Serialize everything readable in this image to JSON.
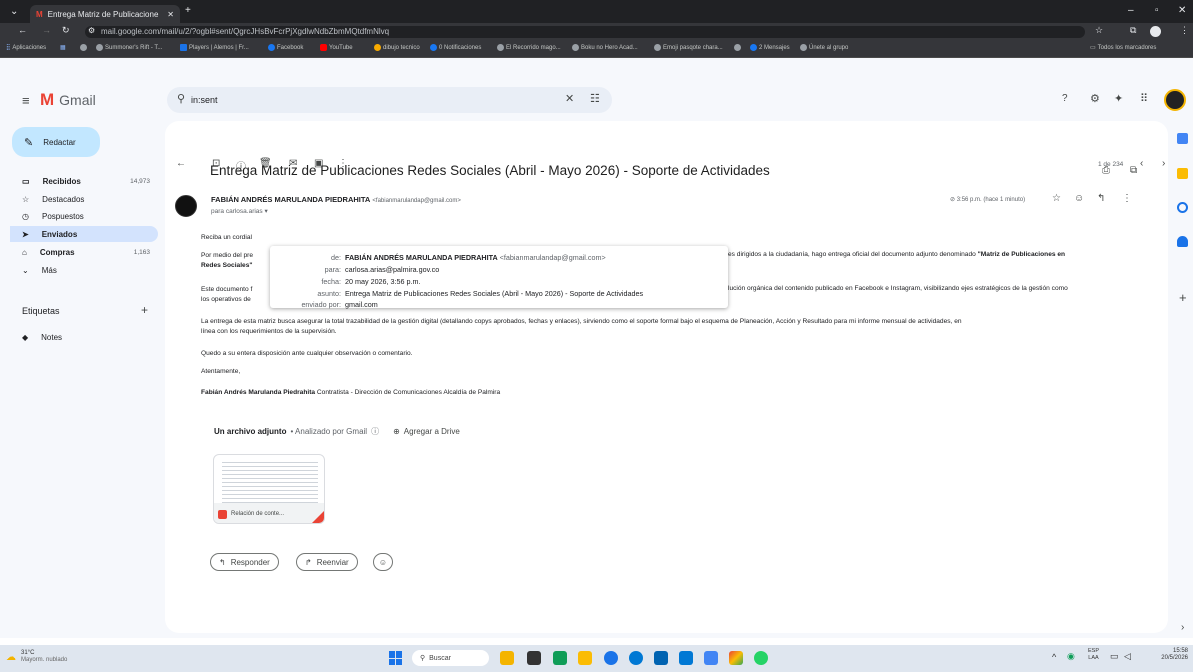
{
  "browser": {
    "tab_title": "Entrega Matriz de Publicacione",
    "url": "mail.google.com/mail/u/2/?ogbl#sent/QgrcJHsBvFcrPjXgdlwNdbZbmMQtdfmNlvq",
    "bookmarks": [
      "Aplicaciones",
      "",
      "Summoner's Rift - T...",
      "Players | Alemos | Fr...",
      "Facebook",
      "YouTube",
      "dibujo tecnico",
      "0 Notificaciones",
      "El Recorrido mago...",
      "Boku no Hero Acad...",
      "Emoji pasqote chara...",
      "",
      "2 Mensajes",
      "Únete al grupo"
    ],
    "bookmarks_right": "Todos los marcadores"
  },
  "gmail": {
    "logo": "Gmail",
    "search_value": "in:sent",
    "compose": "Redactar",
    "nav": [
      {
        "label": "Recibidos",
        "count": "14,973",
        "bold": true
      },
      {
        "label": "Destacados",
        "count": ""
      },
      {
        "label": "Pospuestos",
        "count": ""
      },
      {
        "label": "Enviados",
        "count": "",
        "bold": true
      },
      {
        "label": "Compras",
        "count": "1,163",
        "bold": true
      },
      {
        "label": "Más",
        "count": ""
      }
    ],
    "labels_heading": "Etiquetas",
    "labels": [
      "Notes"
    ],
    "pager": "1 de 234",
    "subject": "Entrega Matriz de Publicaciones Redes Sociales (Abril - Mayo 2026) - Soporte de Actividades",
    "sender_name": "FABIÁN ANDRÉS MARULANDA PIEDRAHITA",
    "sender_email": "<fabianmarulandap@gmail.com>",
    "to_line": "para carlosa.arias",
    "time": "3:56 p.m. (hace 1 minuto)",
    "details": {
      "from_k": "de:",
      "from_name": "FABIÁN ANDRÉS MARULANDA PIEDRAHITA",
      "from_email": "<fabianmarulandap@gmail.com>",
      "to_k": "para:",
      "to_v": "carlosa.arias@palmira.gov.co",
      "date_k": "fecha:",
      "date_v": "20 may 2026, 3:56 p.m.",
      "subj_k": "asunto:",
      "subj_v": "Entrega Matriz de Publicaciones Redes Sociales (Abril - Mayo 2026) - Soporte de Actividades",
      "via_k": "enviado por:",
      "via_v": "gmail.com"
    },
    "body": {
      "p1": "Reciba un cordial",
      "p2a": "Por medio del pre",
      "p2b": "es dirigidos a la ciudadanía, hago entrega oficial del documento adjunto denominado",
      "p2c": "\"Matriz de Publicaciones en",
      "p2d": "Redes Sociales\"",
      "p3a": "Este documento f",
      "p3b": "lución orgánica del contenido publicado en Facebook e Instagram, visibilizando ejes estratégicos de la gestión como",
      "p3c": "los operativos de",
      "p4": "La entrega de esta matriz busca asegurar la total trazabilidad de la gestión digital (detallando copys aprobados, fechas y enlaces), sirviendo como el soporte formal bajo el esquema de Planeación, Acción y Resultado para mi informe mensual de actividades, en",
      "p4b": "línea con los requerimientos de la supervisión.",
      "p5": "Quedo a su entera disposición ante cualquier observación o comentario.",
      "p6": "Atentamente,",
      "p7a": "Fabián Andrés Marulanda Piedrahita",
      "p7b": "Contratista - Dirección de Comunicaciones Alcaldía de Palmira"
    },
    "attach_head": "Un archivo adjunto",
    "attach_scan": "• Analizado por Gmail",
    "attach_drive": "Agregar a Drive",
    "attach_name": "Relación de conte...",
    "reply": "Responder",
    "forward": "Reenviar"
  },
  "taskbar": {
    "weather_temp": "31°C",
    "weather_desc": "Mayorm. nublado",
    "search": "Buscar",
    "lang1": "ESP",
    "lang2": "LAA",
    "time": "15:58",
    "date": "20/5/2026"
  }
}
